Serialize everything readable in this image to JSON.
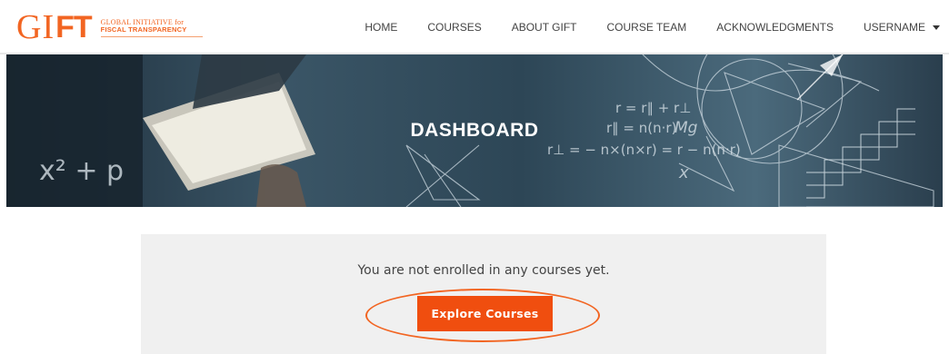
{
  "logo": {
    "mark_left": "GI",
    "mark_right": "FT",
    "line1": "GLOBAL INITIATIVE for",
    "line2": "FISCAL TRANSPARENCY"
  },
  "nav": {
    "items": [
      "HOME",
      "COURSES",
      "ABOUT GIFT",
      "COURSE TEAM",
      "ACKNOWLEDGMENTS"
    ],
    "user_menu": "USERNAME"
  },
  "hero": {
    "title": "DASHBOARD",
    "formulas": {
      "f1": "r = r∥ + r⊥",
      "f2": "r∥ = n(n·r)",
      "f3": "r⊥ = − n×(n×r) = r − n(n·r)",
      "f4": "Mg",
      "f5": "x² + p",
      "f6": "x"
    }
  },
  "main": {
    "message": "You are not enrolled in any courses yet.",
    "explore_label": "Explore Courses"
  },
  "colors": {
    "brand": "#f26522",
    "button": "#f04e0f",
    "panel": "#f0f0f0"
  }
}
